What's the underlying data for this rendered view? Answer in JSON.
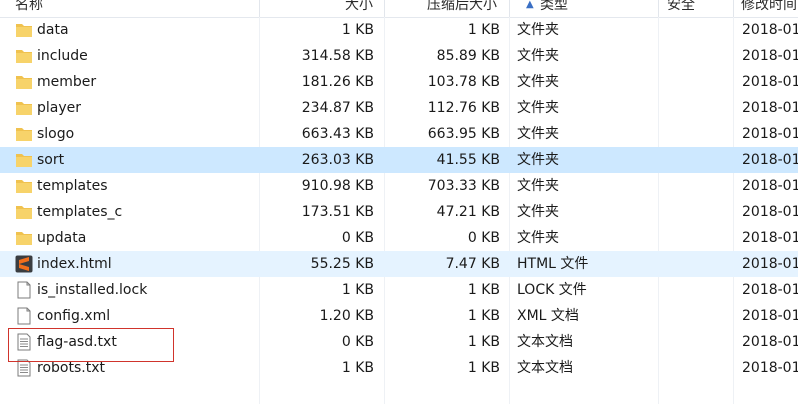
{
  "header": {
    "name": "名称",
    "size": "大小",
    "compressed_size": "压缩后大小",
    "sort_indicator": "▲",
    "type": "类型",
    "security": "安全",
    "modified": "修改时间"
  },
  "files": [
    {
      "name": "data",
      "size": "1 KB",
      "compressed_size": "1 KB",
      "type": "文件夹",
      "modified": "2018-01",
      "icon": "folder-icon"
    },
    {
      "name": "include",
      "size": "314.58 KB",
      "compressed_size": "85.89 KB",
      "type": "文件夹",
      "modified": "2018-01",
      "icon": "folder-icon"
    },
    {
      "name": "member",
      "size": "181.26 KB",
      "compressed_size": "103.78 KB",
      "type": "文件夹",
      "modified": "2018-01",
      "icon": "folder-icon"
    },
    {
      "name": "player",
      "size": "234.87 KB",
      "compressed_size": "112.76 KB",
      "type": "文件夹",
      "modified": "2018-01",
      "icon": "folder-icon"
    },
    {
      "name": "slogo",
      "size": "663.43 KB",
      "compressed_size": "663.95 KB",
      "type": "文件夹",
      "modified": "2018-01",
      "icon": "folder-icon"
    },
    {
      "name": "sort",
      "size": "263.03 KB",
      "compressed_size": "41.55 KB",
      "type": "文件夹",
      "modified": "2018-01",
      "icon": "folder-icon",
      "state": "selected"
    },
    {
      "name": "templates",
      "size": "910.98 KB",
      "compressed_size": "703.33 KB",
      "type": "文件夹",
      "modified": "2018-01",
      "icon": "folder-icon"
    },
    {
      "name": "templates_c",
      "size": "173.51 KB",
      "compressed_size": "47.21 KB",
      "type": "文件夹",
      "modified": "2018-01",
      "icon": "folder-icon"
    },
    {
      "name": "updata",
      "size": "0 KB",
      "compressed_size": "0 KB",
      "type": "文件夹",
      "modified": "2018-01",
      "icon": "folder-icon"
    },
    {
      "name": "index.html",
      "size": "55.25 KB",
      "compressed_size": "7.47 KB",
      "type": "HTML 文件",
      "modified": "2018-01",
      "icon": "sublime-file-icon",
      "state": "hover"
    },
    {
      "name": "is_installed.lock",
      "size": "1 KB",
      "compressed_size": "1 KB",
      "type": "LOCK 文件",
      "modified": "2018-01",
      "icon": "blank-file-icon"
    },
    {
      "name": "config.xml",
      "size": "1.20 KB",
      "compressed_size": "1 KB",
      "type": "XML 文档",
      "modified": "2018-01",
      "icon": "blank-file-icon"
    },
    {
      "name": "flag-asd.txt",
      "size": "0 KB",
      "compressed_size": "1 KB",
      "type": "文本文档",
      "modified": "2018-01",
      "icon": "text-file-icon",
      "highlight": "red-box"
    },
    {
      "name": "robots.txt",
      "size": "1 KB",
      "compressed_size": "1 KB",
      "type": "文本文档",
      "modified": "2018-01",
      "icon": "text-file-icon"
    }
  ],
  "colors": {
    "selected_row": "#cde8ff",
    "hover_row": "#e5f3ff",
    "folder": "#f0c24f",
    "highlight_border": "#d0342c",
    "sublime_icon": "#f26e1b"
  }
}
